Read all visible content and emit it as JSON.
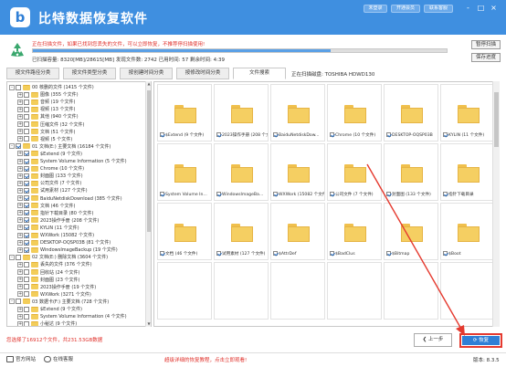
{
  "app": {
    "title": "比特数据恢复软件",
    "logo_letter": "b",
    "header_buttons": [
      "未登录",
      "开通会员",
      "联系客服"
    ],
    "window_controls": [
      "-",
      "□",
      "×"
    ]
  },
  "status": {
    "line1": "正在扫描文件，如果已找到您丢失的文件，可以立即恢复，不推荐停扫描使用!",
    "progress": 0.72,
    "line2": "已扫描容量: 8320[MB]/28615[MB]    发现文件数: 2742    已用时间: 57    剩余时间: 4:39",
    "pause_label": "暂停扫描",
    "save_label": "保存进度"
  },
  "tabs": [
    "按文件路径分类",
    "按文件类型分类",
    "按创建时间分类",
    "按修改时间分类",
    "文件搜索"
  ],
  "active_tab": 4,
  "scan_path": "正在扫描磁盘: TOSHIBA HDWD130",
  "tree": [
    {
      "d": 0,
      "e": "-",
      "t": "00 核删的文件 (1415 个文件)"
    },
    {
      "d": 1,
      "e": "+",
      "t": "图像 (355 个文件)"
    },
    {
      "d": 1,
      "e": "+",
      "t": "音频 (19 个文件)"
    },
    {
      "d": 1,
      "e": "+",
      "t": "视频 (13 个文件)"
    },
    {
      "d": 1,
      "e": "+",
      "t": "其他 (940 个文件)"
    },
    {
      "d": 1,
      "e": "+",
      "t": "压缩文件 (32 个文件)"
    },
    {
      "d": 1,
      "e": "+",
      "t": "文档 (51 个文件)"
    },
    {
      "d": 1,
      "e": "+",
      "t": "视频 (5 个文件)"
    },
    {
      "d": 0,
      "e": "-",
      "t": "01 文档(E:) 主要文档 (16184 个文件)",
      "c": true
    },
    {
      "d": 1,
      "e": "+",
      "t": "$Extend (9 个文件)",
      "c": true
    },
    {
      "d": 1,
      "e": "+",
      "t": "System Volume Information (5 个文件)",
      "c": true
    },
    {
      "d": 1,
      "e": "+",
      "t": "Chrome (10 个文件)",
      "c": true
    },
    {
      "d": 1,
      "e": "+",
      "t": "封面图 (133 个文件)",
      "c": true
    },
    {
      "d": 1,
      "e": "+",
      "t": "公司文件 (7 个文件)",
      "c": true
    },
    {
      "d": 1,
      "e": "+",
      "t": "试用素材 (127 个文件)",
      "c": true
    },
    {
      "d": 1,
      "e": "+",
      "t": "BaiduNetdiskDownload (385 个文件)",
      "c": true
    },
    {
      "d": 1,
      "e": "+",
      "t": "文档 (46 个文件)",
      "c": true
    },
    {
      "d": 1,
      "e": "+",
      "t": "指针下载目录 (80 个文件)",
      "c": true
    },
    {
      "d": 1,
      "e": "+",
      "t": "2023操作手册 (208 个文件)",
      "c": true
    },
    {
      "d": 1,
      "e": "+",
      "t": "KYLIN (11 个文件)",
      "c": true
    },
    {
      "d": 1,
      "e": "+",
      "t": "WXWork (15082 个文件)",
      "c": true
    },
    {
      "d": 1,
      "e": "+",
      "t": "DESKTOP-OQSP03B (81 个文件)",
      "c": true
    },
    {
      "d": 1,
      "e": "+",
      "t": "WindowsImageBackup (19 个文件)",
      "c": true
    },
    {
      "d": 0,
      "e": "-",
      "t": "02 文档(E:) 删除文档 (3604 个文件)"
    },
    {
      "d": 1,
      "e": "+",
      "t": "丢失的文件 (376 个文件)"
    },
    {
      "d": 1,
      "e": "+",
      "t": "回收站 (24 个文件)"
    },
    {
      "d": 1,
      "e": "+",
      "t": "封面图 (23 个文件)"
    },
    {
      "d": 1,
      "e": "+",
      "t": "2023操作手册 (19 个文件)"
    },
    {
      "d": 1,
      "e": "+",
      "t": "WXWork (3271 个文件)"
    },
    {
      "d": 0,
      "e": "-",
      "t": "03 数据卡(F:) 主要文档 (728 个文件)"
    },
    {
      "d": 1,
      "e": "+",
      "t": "$Extend (9 个文件)"
    },
    {
      "d": 1,
      "e": "+",
      "t": "System Volume Information (4 个文件)"
    },
    {
      "d": 1,
      "e": "+",
      "t": "小秘达 (9 个文件)"
    }
  ],
  "tiles": [
    "$Extend (9 个文件)",
    "2023操作手册 (208 个文件)",
    "BaiduNetdiskDow...",
    "Chrome (10 个文件)",
    "DESKTOP-OQSP03B",
    "KYLIN (11 个文件)",
    "System Volume In...",
    "WindowsImageBa...",
    "WXWork (15082 个文件)",
    "公司文件 (7 个文件)",
    "封面图 (133 个文件)",
    "指针下载目录",
    "文档 (46 个文件)",
    "试用素材 (127 个文件)",
    "$AttrDef",
    "$BadClus",
    "$Bitmap",
    "$Boot"
  ],
  "bottom": {
    "selected": "您选择了16912个文件，共231.53GB数据",
    "prev_label": "上一步",
    "recover_label": "恢复"
  },
  "footer": {
    "website": "官方网站",
    "support": "在线客服",
    "notice": "超级详细的恢复教程，点击立即观看!",
    "version": "版本: 8.3.5"
  },
  "colors": {
    "accent": "#3f8fe0",
    "warning": "#e0302a",
    "highlight": "#e53a2f"
  }
}
